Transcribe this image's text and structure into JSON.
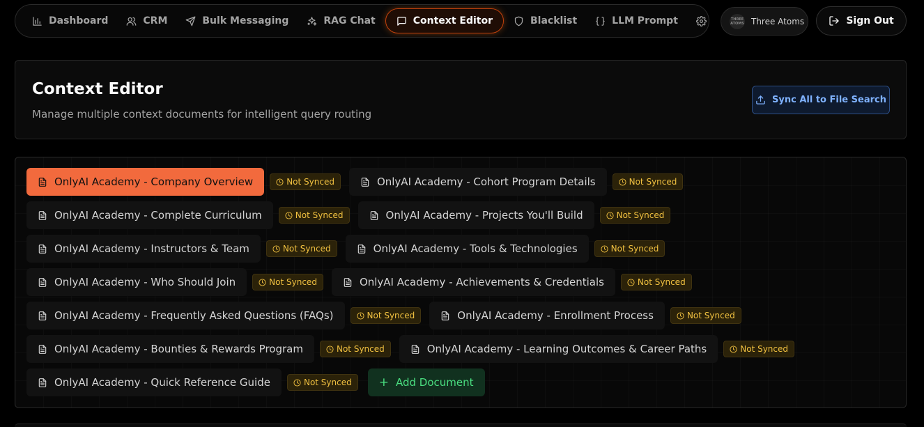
{
  "nav": {
    "items": [
      {
        "label": "Dashboard",
        "icon": "bar-chart-icon"
      },
      {
        "label": "CRM",
        "icon": "users-icon"
      },
      {
        "label": "Bulk Messaging",
        "icon": "send-icon"
      },
      {
        "label": "RAG Chat",
        "icon": "sparkles-icon"
      },
      {
        "label": "Context Editor",
        "icon": "message-square-icon",
        "active": true
      },
      {
        "label": "Blacklist",
        "icon": "shield-icon"
      },
      {
        "label": "LLM Prompt",
        "icon": "braces-icon"
      },
      {
        "label": "Settings",
        "icon": "gear-icon"
      }
    ]
  },
  "org": {
    "name": "Three Atoms",
    "logo_text": "THREE ATOMS"
  },
  "signout": {
    "label": "Sign Out"
  },
  "header": {
    "title": "Context Editor",
    "subtitle": "Manage multiple context documents for intelligent query routing",
    "sync_label": "Sync All to File Search"
  },
  "documents": [
    {
      "name": "OnlyAI Academy - Company Overview",
      "status": "Not Synced",
      "active": true
    },
    {
      "name": "OnlyAI Academy - Cohort Program Details",
      "status": "Not Synced"
    },
    {
      "name": "OnlyAI Academy - Complete Curriculum",
      "status": "Not Synced"
    },
    {
      "name": "OnlyAI Academy - Projects You'll Build",
      "status": "Not Synced"
    },
    {
      "name": "OnlyAI Academy - Instructors & Team",
      "status": "Not Synced"
    },
    {
      "name": "OnlyAI Academy - Tools & Technologies",
      "status": "Not Synced"
    },
    {
      "name": "OnlyAI Academy - Who Should Join",
      "status": "Not Synced"
    },
    {
      "name": "OnlyAI Academy - Achievements & Credentials",
      "status": "Not Synced"
    },
    {
      "name": "OnlyAI Academy - Frequently Asked Questions (FAQs)",
      "status": "Not Synced"
    },
    {
      "name": "OnlyAI Academy - Enrollment Process",
      "status": "Not Synced"
    },
    {
      "name": "OnlyAI Academy - Bounties & Rewards Program",
      "status": "Not Synced"
    },
    {
      "name": "OnlyAI Academy - Learning Outcomes & Career Paths",
      "status": "Not Synced"
    },
    {
      "name": "OnlyAI Academy - Quick Reference Guide",
      "status": "Not Synced"
    }
  ],
  "add_document_label": "Add Document",
  "colors": {
    "accent": "#f26a3d",
    "status_warning": "#f0c040",
    "add_green": "#4ade80",
    "sync_blue": "#7fb2ff"
  }
}
